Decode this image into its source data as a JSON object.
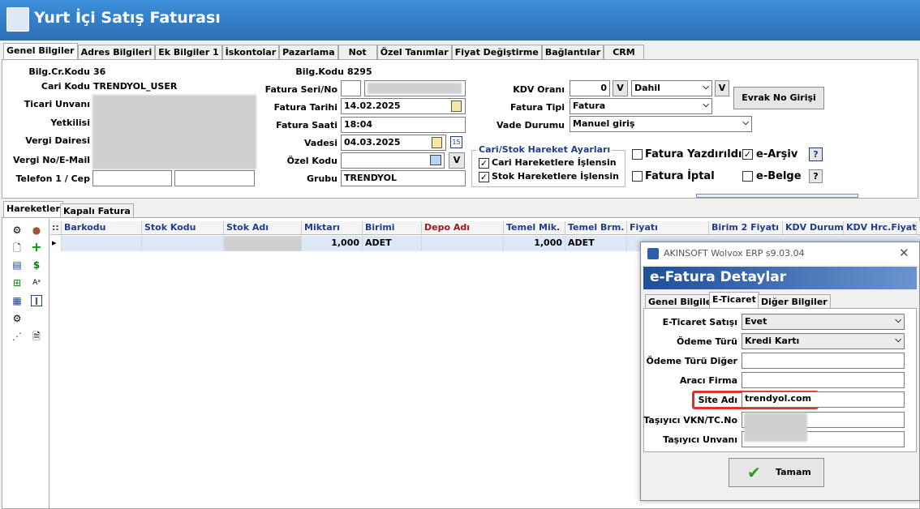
{
  "window": {
    "title": "Yurt İçi Satış Faturası"
  },
  "tabs": [
    "Genel Bilgiler",
    "Adres Bilgileri",
    "Ek Bilgiler 1",
    "İskontolar",
    "Pazarlama",
    "Not",
    "Özel Tanımlar",
    "Fiyat Değiştirme",
    "Bağlantılar",
    "CRM"
  ],
  "cari": {
    "bilg_cr_kodu_label": "Bilg.Cr.Kodu",
    "bilg_cr_kodu": "36",
    "cari_kodu_label": "Cari Kodu",
    "cari_kodu": "TRENDYOL_USER",
    "ticari_unvani_label": "Ticari Unvanı",
    "yetkilisi_label": "Yetkilisi",
    "vergi_dairesi_label": "Vergi Dairesi",
    "vergi_no_label": "Vergi No/E-Mail",
    "telefon_label": "Telefon 1 / Cep"
  },
  "fatura": {
    "bilg_kodu_label": "Bilg.Kodu",
    "bilg_kodu": "8295",
    "seri_no_label": "Fatura Seri/No",
    "tarih_label": "Fatura Tarihi",
    "tarih": "14.02.2025",
    "saat_label": "Fatura Saati",
    "saat": "18:04",
    "vadesi_label": "Vadesi",
    "vadesi": "04.03.2025",
    "ozel_kodu_label": "Özel Kodu",
    "grubu_label": "Grubu",
    "grubu": "TRENDYOL",
    "v_label": "V"
  },
  "kdv": {
    "orani_label": "KDV Oranı",
    "orani": "0",
    "v_label": "V",
    "dahil": "Dahil",
    "fatura_tipi_label": "Fatura Tipi",
    "fatura_tipi": "Fatura",
    "vade_durumu_label": "Vade Durumu",
    "vade_durumu": "Manuel giriş",
    "evrak_button": "Evrak No Girişi"
  },
  "hareket_ayarlari": {
    "title": "Cari/Stok Hareket Ayarları",
    "cari": "Cari Hareketlere İşlensin",
    "stok": "Stok Hareketlere İşlensin"
  },
  "flags": {
    "yazdirildi": "Fatura Yazdırıldı",
    "iptal": "Fatura İptal",
    "earsiv": "e-Arşiv",
    "ebelge": "e-Belge",
    "help": "?"
  },
  "lower_tabs": [
    "Hareketler",
    "Kapalı Fatura"
  ],
  "grid": {
    "headers": [
      "Barkodu",
      "Stok Kodu",
      "Stok Adı",
      "Miktarı",
      "Birimi",
      "Depo Adı",
      "Temel Mik.",
      "Temel Brm.",
      "Fiyatı",
      "Birim 2 Fiyatı",
      "KDV Durumu",
      "KDV Hrc.Fiyat"
    ],
    "row": {
      "miktari": "1,000",
      "birimi": "ADET",
      "temel_mik": "1,000",
      "temel_brm": "ADET"
    }
  },
  "dialog": {
    "app_title": "AKINSOFT Wolvox ERP s9.03.04",
    "header": "e-Fatura Detaylar",
    "tabs": [
      "Genel Bilgiler",
      "E-Ticaret",
      "Diğer Bilgiler"
    ],
    "fields": {
      "eticaret_satisi_label": "E-Ticaret Satışı",
      "eticaret_satisi": "Evet",
      "odeme_turu_label": "Ödeme Türü",
      "odeme_turu": "Kredi Kartı",
      "odeme_turu_diger_label": "Ödeme Türü Diğer",
      "araci_firma_label": "Aracı Firma",
      "site_adi_label": "Site Adı",
      "site_adi": "trendyol.com",
      "tasiyici_vkn_label": "Taşıyıcı VKN/TC.No",
      "tasiyici_unvani_label": "Taşıyıcı Unvanı"
    },
    "ok_button": "Tamam"
  },
  "colors": {
    "title_bg": "#2b6fb8",
    "header_text": "#1f3d8c",
    "dialog_header": "#1f4f96",
    "highlight": "#d9342b"
  }
}
